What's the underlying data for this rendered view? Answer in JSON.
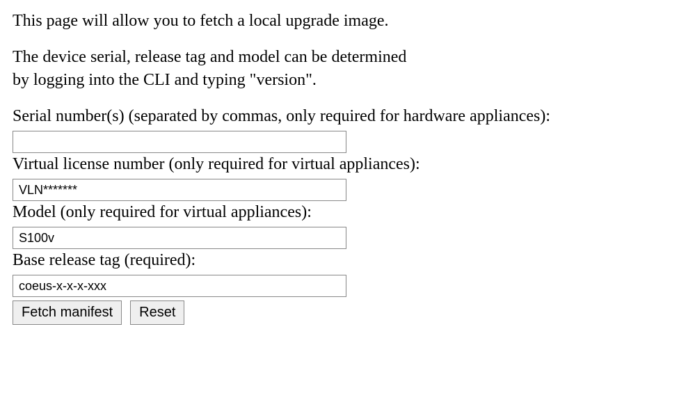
{
  "intro": "This page will allow you to fetch a local upgrade image.",
  "help_line1": "The device serial, release tag and model can be determined",
  "help_line2": "by logging into the CLI and typing \"version\".",
  "form": {
    "serial": {
      "label": "Serial number(s) (separated by commas, only required for hardware appliances):",
      "value": "",
      "placeholder": ""
    },
    "vln": {
      "label": "Virtual license number (only required for virtual appliances):",
      "value": "",
      "placeholder": "VLN*******"
    },
    "model": {
      "label": "Model (only required for virtual appliances):",
      "value": "",
      "placeholder": "S100v"
    },
    "release_tag": {
      "label": "Base release tag (required):",
      "value": "",
      "placeholder": "coeus-x-x-x-xxx"
    }
  },
  "buttons": {
    "fetch": "Fetch manifest",
    "reset": "Reset"
  }
}
